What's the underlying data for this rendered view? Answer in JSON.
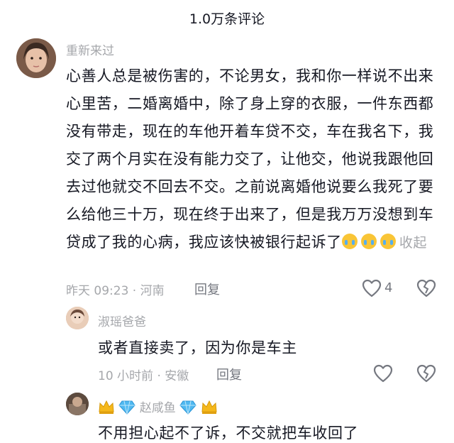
{
  "header": {
    "title": "1.0万条评论"
  },
  "comment": {
    "username": "重新来过",
    "text": "心善人总是被伤害的，不论男女，我和你一样说不出来心里苦，二婚离婚中，除了身上穿的衣服，一件东西都没有带走，现在的车他开着车贷不交，车在我名下，我交了两个月实在没有能力交了，让他交，他说我跟他回去过他就交不回去不交。之前说离婚他说要么我死了要么给他三十万，现在终于出来了，但是我万万没想到车贷成了我的心病，我应该快被银行起诉了",
    "emoji": [
      "crying-face",
      "crying-face",
      "crying-face"
    ],
    "collapse_label": "收起",
    "time_location": "昨天 09:23 · 河南",
    "reply_label": "回复",
    "like_count": "4"
  },
  "replies": [
    {
      "username": "淑瑶爸爸",
      "text": "或者直接卖了，因为你是车主",
      "time_location": "10 小时前 · 安徽",
      "reply_label": "回复"
    },
    {
      "username": "赵咸鱼",
      "text": "不用担心起不了诉，不交就把车收回了",
      "badges": [
        "crown-icon",
        "diamond-icon"
      ]
    }
  ],
  "colors": {
    "text": "#161823",
    "muted": "#a5a7ab",
    "action": "#757880"
  }
}
